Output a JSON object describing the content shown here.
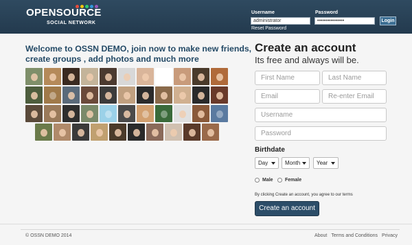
{
  "header": {
    "logo_main": "OPENSOURCE",
    "logo_sub": "SOCIAL NETWORK",
    "logo_dot_colors": [
      "#e74c3c",
      "#f1c40f",
      "#2ecc71",
      "#3498db",
      "#9b59b6"
    ],
    "username_label": "Username",
    "username_value": "administrator",
    "password_label": "Password",
    "password_value": "••••••••••••••••",
    "reset_link": "Reset Password",
    "login_button": "Login"
  },
  "main": {
    "welcome_text": "Welcome to OSSN DEMO, join now to make new friends, create groups , add photos and much more",
    "avatar_rows": [
      [
        "#7f8f6a",
        "#b58a5a",
        "#3a2a20",
        "#c4b49a",
        "#4b3a30",
        "#d8d8d8",
        "#d9b59a",
        "#ffffff",
        "#c89b7b",
        "#4a3b2b",
        "#b06a3a"
      ],
      [
        "#4d5d3d",
        "#a07a4a",
        "#5a6a7a",
        "#6a4a3a",
        "#3b3b3b",
        "#c0a080",
        "#2b2b2b",
        "#8a6a4a",
        "#d0b090",
        "#2a2a2a",
        "#6a3a2a"
      ],
      [
        "#5a4a3a",
        "#9a7a5a",
        "#2e2e2e",
        "#7a8a6a",
        "#9bd1e8",
        "#4a4a4a",
        "#d2a070",
        "#3a6a3a",
        "#e0e0e0",
        "#8a5a3a",
        "#5a7aa0"
      ],
      [
        "#6a7a4a",
        "#b08a6a",
        "#3a3a3a",
        "#c0a070",
        "#4a3a2a",
        "#2a2a2a",
        "#8a6a5a",
        "#d0c0b0",
        "#5a3a2a",
        "#9a6a4a"
      ]
    ],
    "cartoon_avatars": [
      "0-7",
      "1-1",
      "2-4",
      "2-6",
      "2-7",
      "2-10"
    ]
  },
  "signup": {
    "title": "Create an account",
    "subtitle": "Its free and always will be.",
    "first_name_placeholder": "First Name",
    "last_name_placeholder": "Last Name",
    "email_placeholder": "Email",
    "reenter_email_placeholder": "Re-enter Email",
    "username_placeholder": "Username",
    "password_placeholder": "Password",
    "birthdate_label": "Birthdate",
    "day_select": "Day",
    "month_select": "Month",
    "year_select": "Year",
    "male_label": "Male",
    "female_label": "Female",
    "terms_text": "By clicking Create an account, you agree to our terms",
    "create_button": "Create an account"
  },
  "footer": {
    "copyright": "© OSSN DEMO 2014",
    "links": [
      "About",
      "Terms and Conditions",
      "Privacy"
    ]
  }
}
